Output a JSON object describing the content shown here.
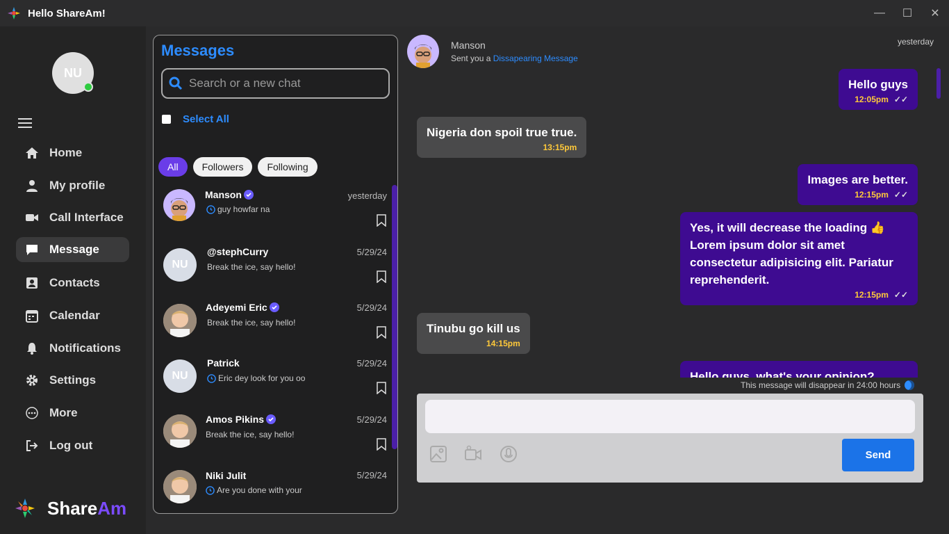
{
  "window": {
    "title": "Hello ShareAm!",
    "controls": [
      "minimize",
      "maximize",
      "close"
    ]
  },
  "sidebar": {
    "avatar_initials": "NU",
    "online": true,
    "items": [
      {
        "label": "Home",
        "icon": "home-icon"
      },
      {
        "label": "My profile",
        "icon": "user-icon"
      },
      {
        "label": "Call Interface",
        "icon": "video-icon"
      },
      {
        "label": "Message",
        "icon": "message-icon",
        "active": true
      },
      {
        "label": "Contacts",
        "icon": "contact-card-icon"
      },
      {
        "label": "Calendar",
        "icon": "calendar-icon"
      },
      {
        "label": "Notifications",
        "icon": "bell-icon"
      },
      {
        "label": "Settings",
        "icon": "gear-icon"
      },
      {
        "label": "More",
        "icon": "more-icon"
      },
      {
        "label": "Log out",
        "icon": "logout-icon"
      }
    ],
    "brand": {
      "part1": "Share",
      "part2": "Am"
    }
  },
  "chatlist": {
    "title": "Messages",
    "search_placeholder": "Search or a new chat",
    "select_all": "Select All",
    "filters": [
      "All",
      "Followers",
      "Following"
    ],
    "active_filter": "All",
    "contacts": [
      {
        "name": "Manson",
        "verified": true,
        "date": "yesterday",
        "preview": "guy howfar na",
        "disappearing": true,
        "avatar": "memoji"
      },
      {
        "name": "@stephCurry",
        "verified": false,
        "date": "5/29/24",
        "preview": "Break the ice, say hello!",
        "disappearing": false,
        "avatar": "NU"
      },
      {
        "name": "Adeyemi Eric",
        "verified": true,
        "date": "5/29/24",
        "preview": "Break the ice, say hello!",
        "disappearing": false,
        "avatar": "photo"
      },
      {
        "name": "Patrick",
        "verified": false,
        "date": "5/29/24",
        "preview": "Eric dey look for you oo",
        "disappearing": true,
        "avatar": "NU"
      },
      {
        "name": "Amos Pikins",
        "verified": true,
        "date": "5/29/24",
        "preview": "Break the ice, say hello!",
        "disappearing": false,
        "avatar": "photo"
      },
      {
        "name": "Niki Julit",
        "verified": false,
        "date": "5/29/24",
        "preview": "Are you done with your",
        "disappearing": true,
        "avatar": "photo"
      }
    ]
  },
  "chat": {
    "contact_name": "Manson",
    "sub_prefix": "Sent you a ",
    "sub_link": "Dissapearing Message",
    "date": "yesterday",
    "messages": [
      {
        "dir": "out",
        "text": "Hello guys",
        "time": "12:05pm"
      },
      {
        "dir": "in",
        "text": "Nigeria don spoil true true.",
        "time": "13:15pm"
      },
      {
        "dir": "out",
        "text": "Images are better.",
        "time": "12:15pm"
      },
      {
        "dir": "out",
        "text": "Yes, it will decrease the loading 👍 Lorem ipsum dolor sit amet consectetur adipisicing elit. Pariatur reprehenderit.",
        "time": "12:15pm"
      },
      {
        "dir": "in",
        "text": "Tinubu go kill us",
        "time": "14:15pm"
      },
      {
        "dir": "out",
        "text": "Hello guys, what's your opinion?Lorem",
        "time": ""
      }
    ],
    "disappear_note": "This message will disappear in 24:00 hours",
    "composer": {
      "value": "",
      "send_label": "Send"
    }
  },
  "colors": {
    "accent": "#2d8cff",
    "brand_purple": "#7b4bff",
    "bubble_out": "#3e0b91",
    "bubble_in": "#4a4a4b",
    "time": "#ffc93a",
    "send": "#1b73e8"
  }
}
